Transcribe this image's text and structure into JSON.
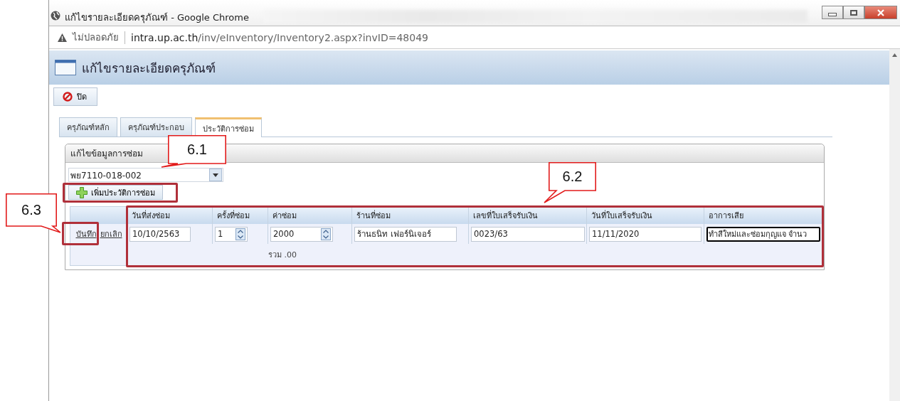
{
  "browser": {
    "title": "แก้ไขรายละเอียดครุภัณฑ์ - Google Chrome",
    "security_label": "ไม่ปลอดภัย",
    "url_host": "intra.up.ac.th",
    "url_path": "/inv/eInventory/Inventory2.aspx?invID=48049"
  },
  "page": {
    "title": "แก้ไขรายละเอียดครุภัณฑ์",
    "close_button": "ปิด"
  },
  "tabs": [
    {
      "label": "ครุภัณฑ์หลัก",
      "selected": false
    },
    {
      "label": "ครุภัณฑ์ประกอบ",
      "selected": false
    },
    {
      "label": "ประวัติการซ่อม",
      "selected": true
    }
  ],
  "panel": {
    "title": "แก้ไขข้อมูลการซ่อม",
    "selector_value": "พย7110-018-002",
    "add_button": "เพิ่มประวัติการซ่อม",
    "columns": [
      "วันที่ส่งซ่อม",
      "ครั้งที่ซ่อม",
      "ค่าซ่อม",
      "ร้านที่ซ่อม",
      "เลขที่ใบเสร็จรับเงิน",
      "วันที่ใบเสร็จรับเงิน",
      "อาการเสีย"
    ],
    "rows": [
      {
        "save_link": "บันทึก",
        "cancel_link": "ยกเลิก",
        "cells": [
          {
            "kind": "text",
            "value": "10/10/2563",
            "focused": false
          },
          {
            "kind": "spinner",
            "value": "1",
            "focused": false
          },
          {
            "kind": "spinner",
            "value": "2000",
            "focused": false
          },
          {
            "kind": "text",
            "value": "ร้านธนิท เฟอร์นิเจอร์",
            "focused": false
          },
          {
            "kind": "text",
            "value": "0023/63",
            "focused": false
          },
          {
            "kind": "text",
            "value": "11/11/2020",
            "focused": false
          },
          {
            "kind": "text",
            "value": "ทำสีใหม่และซ่อมกุญแจ จำนว",
            "focused": true
          }
        ]
      }
    ],
    "total": "รวม .00"
  },
  "annotations": [
    {
      "label": "6.1"
    },
    {
      "label": "6.2"
    },
    {
      "label": "6.3"
    }
  ]
}
